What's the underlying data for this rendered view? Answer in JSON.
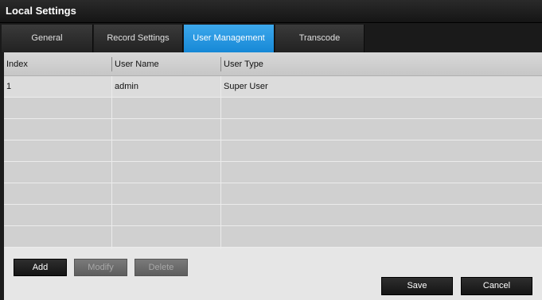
{
  "window": {
    "title": "Local Settings"
  },
  "tabs": [
    {
      "label": "General",
      "active": false
    },
    {
      "label": "Record Settings",
      "active": false
    },
    {
      "label": "User Management",
      "active": true
    },
    {
      "label": "Transcode",
      "active": false
    }
  ],
  "table": {
    "columns": [
      "Index",
      "User Name",
      "User Type"
    ],
    "rows": [
      {
        "index": "1",
        "user_name": "admin",
        "user_type": "Super User"
      }
    ]
  },
  "actions": {
    "add": "Add",
    "modify": "Modify",
    "delete": "Delete",
    "save": "Save",
    "cancel": "Cancel"
  },
  "colors": {
    "active_tab": "#2196e0",
    "title_bar": "#1c1c1c",
    "table_background": "#d0d0d0"
  }
}
